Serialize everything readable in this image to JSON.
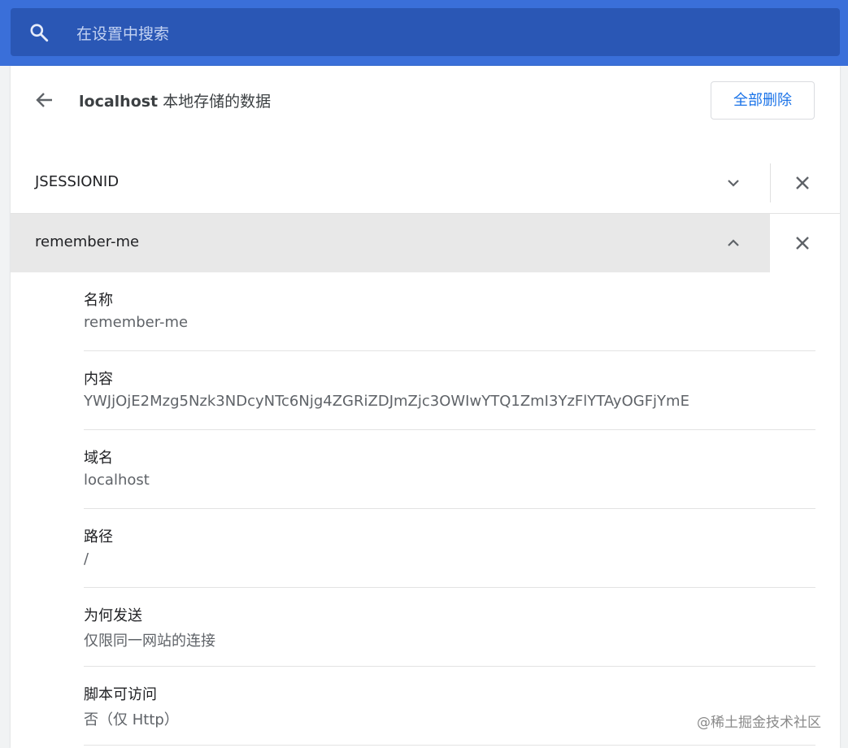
{
  "search": {
    "placeholder": "在设置中搜索"
  },
  "header": {
    "host": "localhost",
    "title_suffix": " 本地存储的数据",
    "remove_all_label": "全部删除"
  },
  "cookies": [
    {
      "name": "JSESSIONID",
      "expanded": false
    },
    {
      "name": "remember-me",
      "expanded": true
    }
  ],
  "details": [
    {
      "label": "名称",
      "value": "remember-me"
    },
    {
      "label": "内容",
      "value": "YWJjOjE2Mzg5Nzk3NDcyNTc6Njg4ZGRiZDJmZjc3OWIwYTQ1ZmI3YzFlYTAyOGFjYmE"
    },
    {
      "label": "域名",
      "value": "localhost"
    },
    {
      "label": "路径",
      "value": "/"
    },
    {
      "label": "为何发送",
      "value": "仅限同一网站的连接"
    },
    {
      "label": "脚本可访问",
      "value": "否（仅 Http）"
    }
  ],
  "watermark": "@稀土掘金技术社区",
  "icons": {
    "search": "search-icon",
    "back": "arrow-left-icon",
    "expand": "chevron-down-icon",
    "collapse": "chevron-up-icon",
    "close": "close-icon"
  },
  "colors": {
    "topbar": "#3a6fd9",
    "searchbox": "#2a57b5",
    "accent": "#1a73e8",
    "expanded_row": "#e8e8e8"
  }
}
